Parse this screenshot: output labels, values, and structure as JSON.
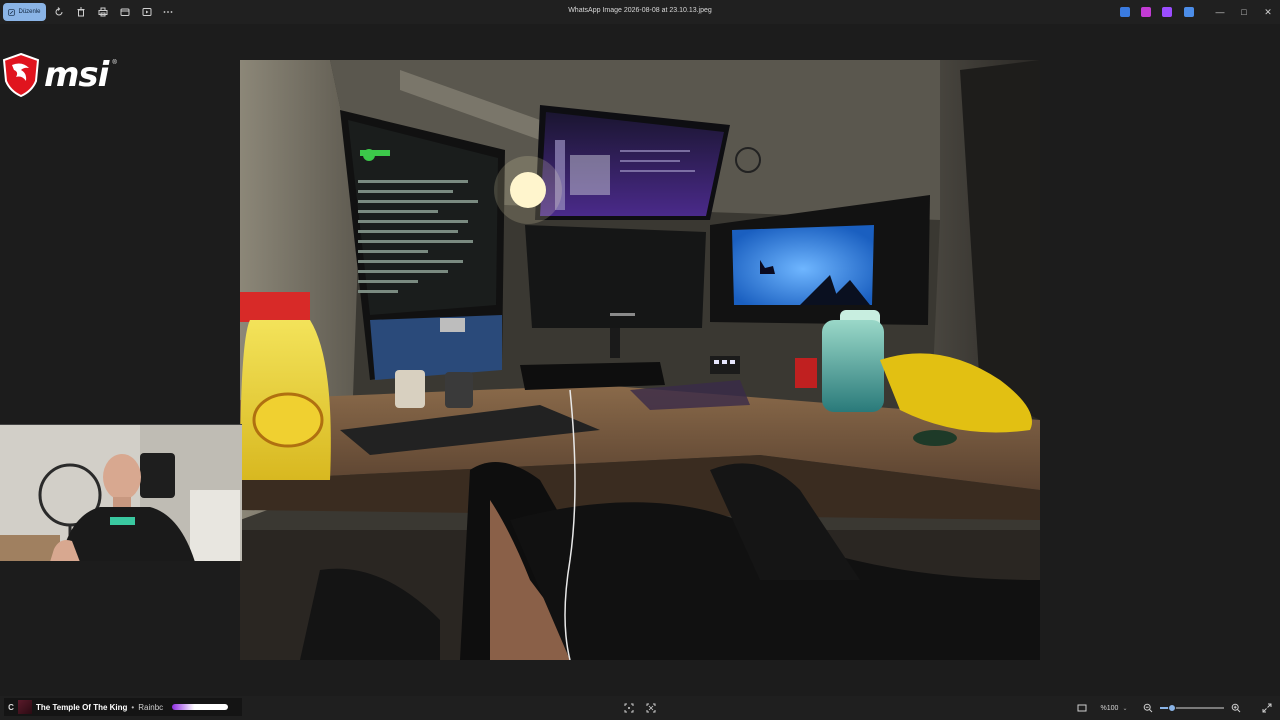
{
  "toolbar": {
    "edit_label": "Düzenle",
    "icons": [
      "rotate-icon",
      "delete-icon",
      "print-icon",
      "slideshow-icon",
      "copy-icon",
      "more-icon"
    ]
  },
  "window": {
    "title": "WhatsApp Image 2026-08-08 at 23.10.13.jpeg",
    "extension_colors": [
      "#3a7be0",
      "#c23bd4",
      "#9b4dff",
      "#4c8de8"
    ]
  },
  "overlay": {
    "brand": "msi",
    "brand_color": "#e0141e"
  },
  "now_playing": {
    "prefix": "C",
    "title": "The Temple Of The King",
    "separator": "•",
    "artist": "Rainbc",
    "progress": 1.0
  },
  "viewer": {
    "zoom_label": "%100",
    "zoom_fraction": 0.18,
    "accent": "#8ab4e6"
  }
}
